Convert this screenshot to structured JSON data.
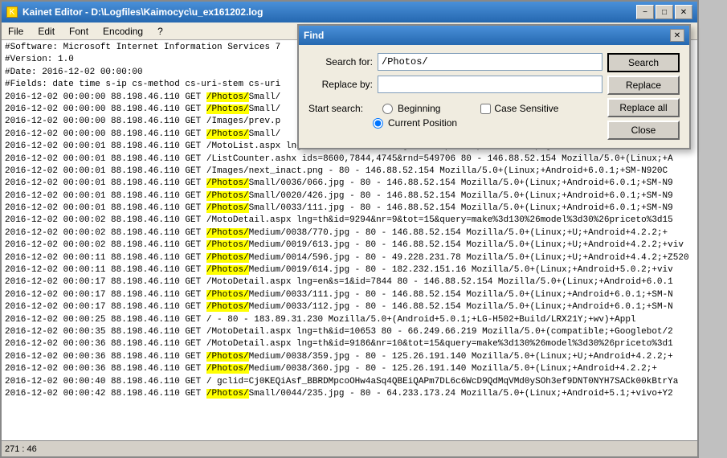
{
  "window": {
    "title": "Kainet Editor - D:\\Logfiles\\Kaimocyc\\u_ex161202.log",
    "minimize_label": "−",
    "maximize_label": "□",
    "close_label": "✕"
  },
  "menu": {
    "items": [
      "File",
      "Edit",
      "Font",
      "Encoding",
      "?"
    ]
  },
  "editor": {
    "lines": [
      "#Software: Microsoft Internet Information Services 7",
      "#Version: 1.0",
      "#Date: 2016-12-02 00:00:00",
      "#Fields: date time s-ip cs-method cs-uri-stem cs-uri",
      "2016-12-02 00:00:00 88.198.46.110 GET /Photos/Small/",
      "2016-12-02 00:00:00 88.198.46.110 GET /Photos/Small/",
      "2016-12-02 00:00:00 88.198.46.110 GET /Images/prev.p",
      "2016-12-02 00:00:00 88.198.46.110 GET /Photos/Small/",
      "2016-12-02 00:00:01 88.198.46.110 GET /MotoList.aspx lng=en&s=%2Fen%2fChiang-Mai&top=250&province=9&page=3 80 - 146.88.52.154",
      "2016-12-02 00:00:01 88.198.46.110 GET /ListCounter.ashx ids=8600,7844,4745&rnd=549706 80 - 146.88.52.154 Mozilla/5.0+(Linux;+A",
      "2016-12-02 00:00:01 88.198.46.110 GET /Images/next_inact.png - 80 - 146.88.52.154 Mozilla/5.0+(Linux;+Android+6.0.1;+SM-N920C",
      "2016-12-02 00:00:01 88.198.46.110 GET /Photos/Small/0036/066.jpg - 80 - 146.88.52.154 Mozilla/5.0+(Linux;+Android+6.0.1;+SM-N9",
      "2016-12-02 00:00:01 88.198.46.110 GET /Photos/Small/0020/426.jpg - 80 - 146.88.52.154 Mozilla/5.0+(Linux;+Android+6.0.1;+SM-N9",
      "2016-12-02 00:00:01 88.198.46.110 GET /Photos/Small/0033/111.jpg - 80 - 146.88.52.154 Mozilla/5.0+(Linux;+Android+6.0.1;+SM-N9",
      "2016-12-02 00:00:02 88.198.46.110 GET /MotoDetail.aspx lng=th&id=9294&nr=9&tot=15&query=make%3d130%26model%3d30%26priceto%3d15",
      "2016-12-02 00:00:02 88.198.46.110 GET /Photos/Medium/0038/770.jpg - 80 - 146.88.52.154 Mozilla/5.0+(Linux;+U;+Android+4.2.2;+",
      "2016-12-02 00:00:02 88.198.46.110 GET /Photos/Medium/0019/613.jpg - 80 - 146.88.52.154 Mozilla/5.0+(Linux;+U;+Android+4.2.2;+viv",
      "2016-12-02 00:00:11 88.198.46.110 GET /Photos/Medium/0014/596.jpg - 80 - 49.228.231.78 Mozilla/5.0+(Linux;+U;+Android+4.4.2;+Z520",
      "2016-12-02 00:00:11 88.198.46.110 GET /Photos/Medium/0019/614.jpg - 80 - 182.232.151.16 Mozilla/5.0+(Linux;+Android+5.0.2;+viv",
      "2016-12-02 00:00:17 88.198.46.110 GET /MotoDetail.aspx lng=en&s=1&id=7844 80 - 146.88.52.154 Mozilla/5.0+(Linux;+Android+6.0.1",
      "2016-12-02 00:00:17 88.198.46.110 GET /Photos/Medium/0033/111.jpg - 80 - 146.88.52.154 Mozilla/5.0+(Linux;+Android+6.0.1;+SM-N",
      "2016-12-02 00:00:17 88.198.46.110 GET /Photos/Medium/0033/112.jpg - 80 - 146.88.52.154 Mozilla/5.0+(Linux;+Android+6.0.1;+SM-N",
      "2016-12-02 00:00:25 88.198.46.110 GET / - 80 - 183.89.31.230 Mozilla/5.0+(Android+5.0.1;+LG-H502+Build/LRX21Y;+wv)+Appl",
      "2016-12-02 00:00:35 88.198.46.110 GET /MotoDetail.aspx lng=th&id=10653 80 - 66.249.66.219 Mozilla/5.0+(compatible;+Googlebot/2",
      "2016-12-02 00:00:36 88.198.46.110 GET /MotoDetail.aspx lng=th&id=9186&nr=10&tot=15&query=make%3d130%26model%3d30%26priceto%3d1",
      "2016-12-02 00:00:36 88.198.46.110 GET /Photos/Medium/0038/359.jpg - 80 - 125.26.191.140 Mozilla/5.0+(Linux;+U;+Android+4.2.2;+",
      "2016-12-02 00:00:36 88.198.46.110 GET /Photos/Medium/0038/360.jpg - 80 - 125.26.191.140 Mozilla/5.0+(Linux;+Android+4.2.2;+",
      "2016-12-02 00:00:40 88.198.46.110 GET / gclid=Cj0KEQiAsf_BBRDMpcoOHw4aSq4QBEiQAPm7DL6c6WcD9QdMqVMd0ySOh3ef9DNT0NYH7SACk00kBtrYa",
      "2016-12-02 00:00:42 88.198.46.110 GET /Photos/Small/0044/235.jpg - 80 - 64.233.173.24 Mozilla/5.0+(Linux;+Android+5.1;+vivo+Y2"
    ],
    "photos_lines": [
      4,
      5,
      7,
      11,
      12,
      13,
      15,
      16,
      17,
      18,
      20,
      21,
      25,
      26,
      28
    ],
    "status": "271 : 46"
  },
  "find_dialog": {
    "title": "Find",
    "close_label": "✕",
    "search_for_label": "Search for:",
    "search_for_value": "/Photos/",
    "replace_by_label": "Replace by:",
    "replace_by_value": "",
    "start_search_label": "Start search:",
    "beginning_label": "Beginning",
    "current_position_label": "Current Position",
    "case_sensitive_label": "Case Sensitive",
    "search_button": "Search",
    "replace_button": "Replace",
    "replace_all_button": "Replace all",
    "close_button": "Close"
  }
}
